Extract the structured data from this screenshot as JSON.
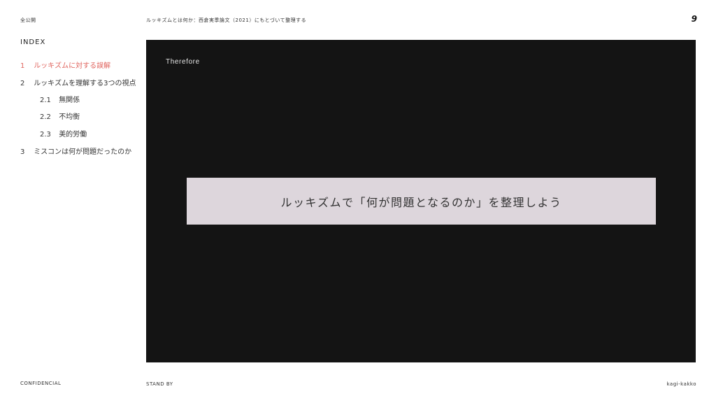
{
  "header": {
    "scope": "全公開",
    "title": "ルッキズムとは何か：西倉実季論文（2021）にもとづいて整理する",
    "page_number": "9"
  },
  "index": {
    "title": "INDEX",
    "items": [
      {
        "num": "1",
        "label": "ルッキズムに対する誤解"
      },
      {
        "num": "2",
        "label": "ルッキズムを理解する3つの視点"
      },
      {
        "num": "2.1",
        "label": "無関係"
      },
      {
        "num": "2.2",
        "label": "不均衡"
      },
      {
        "num": "2.3",
        "label": "美的労働"
      },
      {
        "num": "3",
        "label": "ミスコンは何が問題だったのか"
      }
    ]
  },
  "slide": {
    "label": "Therefore",
    "message": "ルッキズムで「何が問題となるのか」を整理しよう"
  },
  "footer": {
    "left": "CONFIDENCIAL",
    "middle": "STAND BY",
    "right": "kagi-kakko"
  },
  "colors": {
    "accent": "#e0655f",
    "panel": "#141414",
    "message_box": "#ddd6dc"
  }
}
